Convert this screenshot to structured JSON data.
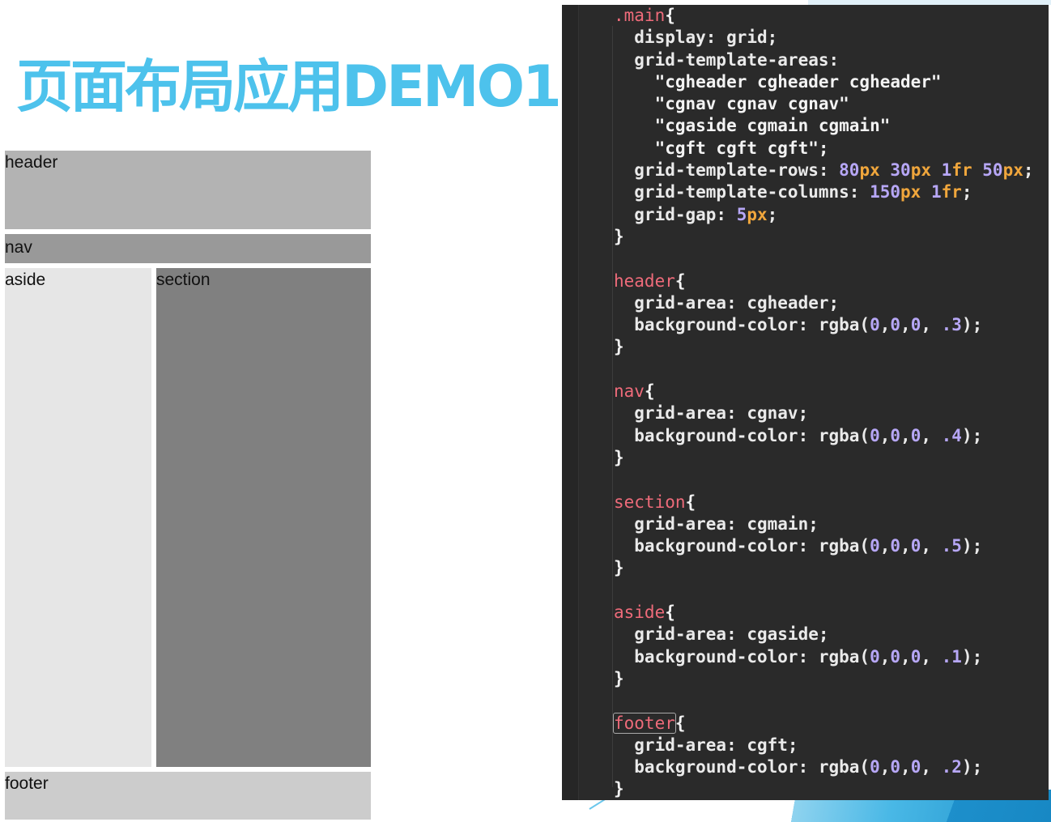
{
  "title": "页面布局应用DEMO1",
  "demo": {
    "header": "header",
    "nav": "nav",
    "aside": "aside",
    "section": "section",
    "footer": "footer"
  },
  "code": {
    "lines": [
      [
        {
          "t": ".main",
          "c": "selector"
        },
        {
          "t": "{",
          "c": "brace"
        }
      ],
      [
        {
          "t": "  display: grid;",
          "c": "prop"
        }
      ],
      [
        {
          "t": "  grid-template-areas:",
          "c": "prop"
        }
      ],
      [
        {
          "t": "    \"cgheader cgheader cgheader\"",
          "c": "str"
        }
      ],
      [
        {
          "t": "    \"cgnav cgnav cgnav\"",
          "c": "str"
        }
      ],
      [
        {
          "t": "    \"cgaside cgmain cgmain\"",
          "c": "str"
        }
      ],
      [
        {
          "t": "    \"cgft cgft cgft\";",
          "c": "str"
        }
      ],
      [
        {
          "t": "  grid-template-rows: ",
          "c": "prop"
        },
        {
          "t": "80",
          "c": "num"
        },
        {
          "t": "px",
          "c": "unit"
        },
        {
          "t": " ",
          "c": "prop"
        },
        {
          "t": "30",
          "c": "num"
        },
        {
          "t": "px",
          "c": "unit"
        },
        {
          "t": " ",
          "c": "prop"
        },
        {
          "t": "1",
          "c": "num"
        },
        {
          "t": "fr",
          "c": "unit"
        },
        {
          "t": " ",
          "c": "prop"
        },
        {
          "t": "50",
          "c": "num"
        },
        {
          "t": "px",
          "c": "unit"
        },
        {
          "t": ";",
          "c": "prop"
        }
      ],
      [
        {
          "t": "  grid-template-columns: ",
          "c": "prop"
        },
        {
          "t": "150",
          "c": "num"
        },
        {
          "t": "px",
          "c": "unit"
        },
        {
          "t": " ",
          "c": "prop"
        },
        {
          "t": "1",
          "c": "num"
        },
        {
          "t": "fr",
          "c": "unit"
        },
        {
          "t": ";",
          "c": "prop"
        }
      ],
      [
        {
          "t": "  grid-gap: ",
          "c": "prop"
        },
        {
          "t": "5",
          "c": "num"
        },
        {
          "t": "px",
          "c": "unit"
        },
        {
          "t": ";",
          "c": "prop"
        }
      ],
      [
        {
          "t": "}",
          "c": "brace"
        }
      ],
      [
        {
          "t": "",
          "c": "prop"
        }
      ],
      [
        {
          "t": "header",
          "c": "selector"
        },
        {
          "t": "{",
          "c": "brace"
        }
      ],
      [
        {
          "t": "  grid-area: cgheader;",
          "c": "prop"
        }
      ],
      [
        {
          "t": "  background-color: rgba(",
          "c": "prop"
        },
        {
          "t": "0",
          "c": "num"
        },
        {
          "t": ",",
          "c": "prop"
        },
        {
          "t": "0",
          "c": "num"
        },
        {
          "t": ",",
          "c": "prop"
        },
        {
          "t": "0",
          "c": "num"
        },
        {
          "t": ", ",
          "c": "prop"
        },
        {
          "t": ".3",
          "c": "num"
        },
        {
          "t": ");",
          "c": "prop"
        }
      ],
      [
        {
          "t": "}",
          "c": "brace"
        }
      ],
      [
        {
          "t": "",
          "c": "prop"
        }
      ],
      [
        {
          "t": "nav",
          "c": "selector"
        },
        {
          "t": "{",
          "c": "brace"
        }
      ],
      [
        {
          "t": "  grid-area: cgnav;",
          "c": "prop"
        }
      ],
      [
        {
          "t": "  background-color: rgba(",
          "c": "prop"
        },
        {
          "t": "0",
          "c": "num"
        },
        {
          "t": ",",
          "c": "prop"
        },
        {
          "t": "0",
          "c": "num"
        },
        {
          "t": ",",
          "c": "prop"
        },
        {
          "t": "0",
          "c": "num"
        },
        {
          "t": ", ",
          "c": "prop"
        },
        {
          "t": ".4",
          "c": "num"
        },
        {
          "t": ");",
          "c": "prop"
        }
      ],
      [
        {
          "t": "}",
          "c": "brace"
        }
      ],
      [
        {
          "t": "",
          "c": "prop"
        }
      ],
      [
        {
          "t": "section",
          "c": "selector"
        },
        {
          "t": "{",
          "c": "brace"
        }
      ],
      [
        {
          "t": "  grid-area: cgmain;",
          "c": "prop"
        }
      ],
      [
        {
          "t": "  background-color: rgba(",
          "c": "prop"
        },
        {
          "t": "0",
          "c": "num"
        },
        {
          "t": ",",
          "c": "prop"
        },
        {
          "t": "0",
          "c": "num"
        },
        {
          "t": ",",
          "c": "prop"
        },
        {
          "t": "0",
          "c": "num"
        },
        {
          "t": ", ",
          "c": "prop"
        },
        {
          "t": ".5",
          "c": "num"
        },
        {
          "t": ");",
          "c": "prop"
        }
      ],
      [
        {
          "t": "}",
          "c": "brace"
        }
      ],
      [
        {
          "t": "",
          "c": "prop"
        }
      ],
      [
        {
          "t": "aside",
          "c": "selector"
        },
        {
          "t": "{",
          "c": "brace"
        }
      ],
      [
        {
          "t": "  grid-area: cgaside;",
          "c": "prop"
        }
      ],
      [
        {
          "t": "  background-color: rgba(",
          "c": "prop"
        },
        {
          "t": "0",
          "c": "num"
        },
        {
          "t": ",",
          "c": "prop"
        },
        {
          "t": "0",
          "c": "num"
        },
        {
          "t": ",",
          "c": "prop"
        },
        {
          "t": "0",
          "c": "num"
        },
        {
          "t": ", ",
          "c": "prop"
        },
        {
          "t": ".1",
          "c": "num"
        },
        {
          "t": ");",
          "c": "prop"
        }
      ],
      [
        {
          "t": "}",
          "c": "brace"
        }
      ],
      [
        {
          "t": "",
          "c": "prop"
        }
      ],
      [
        {
          "t": "footer",
          "c": "selector",
          "boxed": true
        },
        {
          "t": "{",
          "c": "brace"
        }
      ],
      [
        {
          "t": "  grid-area: cgft;",
          "c": "prop"
        }
      ],
      [
        {
          "t": "  background-color: rgba(",
          "c": "prop"
        },
        {
          "t": "0",
          "c": "num"
        },
        {
          "t": ",",
          "c": "prop"
        },
        {
          "t": "0",
          "c": "num"
        },
        {
          "t": ",",
          "c": "prop"
        },
        {
          "t": "0",
          "c": "num"
        },
        {
          "t": ", ",
          "c": "prop"
        },
        {
          "t": ".2",
          "c": "num"
        },
        {
          "t": ");",
          "c": "prop"
        }
      ],
      [
        {
          "t": "}",
          "c": "brace"
        }
      ]
    ]
  }
}
